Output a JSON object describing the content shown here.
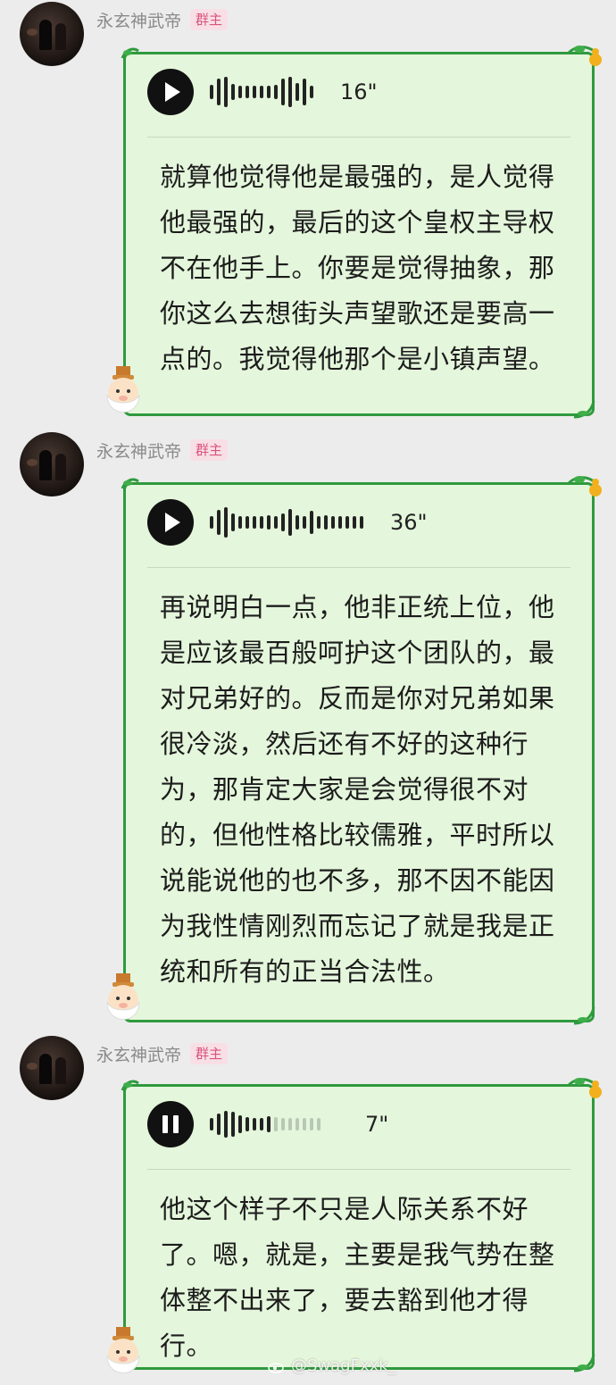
{
  "messages": [
    {
      "sender": "永玄神武帝",
      "role_badge": "群主",
      "voice_duration": "16\"",
      "voice_state": "paused",
      "transcript": "就算他觉得他是最强的，是人觉得他最强的，最后的这个皇权主导权不在他手上。你要是觉得抽象，那你这么去想街头声望歌还是要高一点的。我觉得他那个是小镇声望。"
    },
    {
      "sender": "永玄神武帝",
      "role_badge": "群主",
      "voice_duration": "36\"",
      "voice_state": "paused",
      "transcript": "再说明白一点，他非正统上位，他是应该最百般呵护这个团队的，最对兄弟好的。反而是你对兄弟如果很冷淡，然后还有不好的这种行为，那肯定大家是会觉得很不对的，但他性格比较儒雅，平时所以说能说他的也不多，那不因不能因为我性情刚烈而忘记了就是我是正统和所有的正当合法性。"
    },
    {
      "sender": "永玄神武帝",
      "role_badge": "群主",
      "voice_duration": "7\"",
      "voice_state": "playing",
      "playback_progress": 0.55,
      "transcript": "他这个样子不只是人际关系不好了。嗯，就是，主要是我气势在整体整不出来了，要去豁到他才得行。"
    }
  ],
  "watermark": "@SwagFxxk_",
  "colors": {
    "bubble_bg": "#e4f6db",
    "bubble_border": "#2f9a3e",
    "badge_text": "#d9537a",
    "badge_bg": "#f8dfe6",
    "page_bg": "#ececec"
  },
  "icons": [
    "avatar",
    "play-icon",
    "pause-icon",
    "waveform",
    "vine-corner",
    "gourd-corner",
    "mascot-old-man",
    "weibo-icon"
  ]
}
